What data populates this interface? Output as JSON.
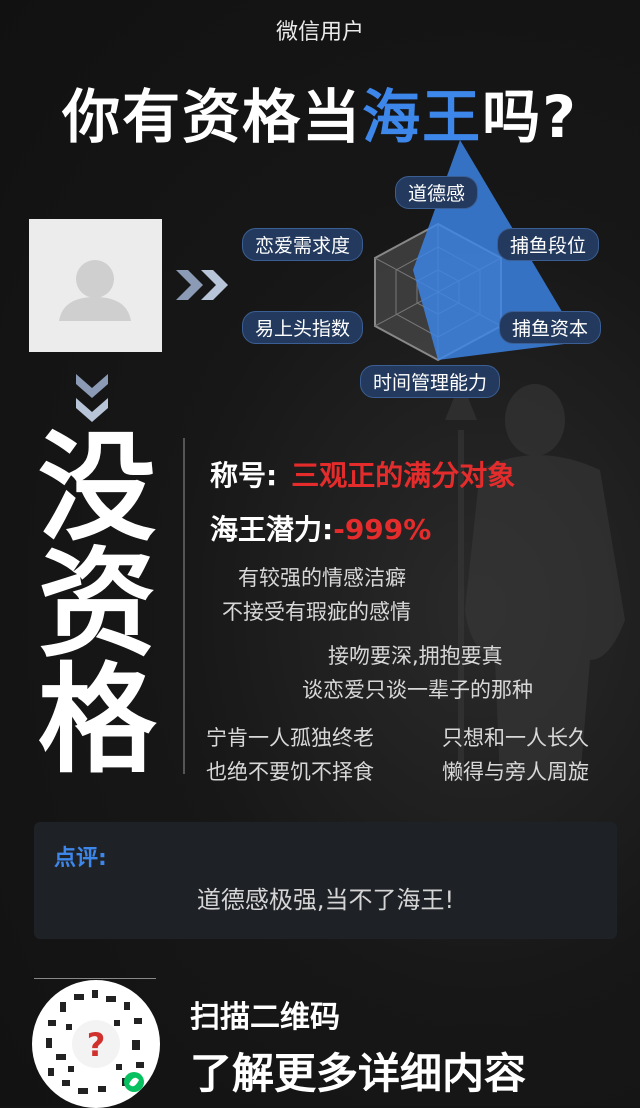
{
  "header": {
    "user": "微信用户",
    "title_pre": "你有资格当",
    "title_highlight": "海王",
    "title_post": "吗?"
  },
  "radar": {
    "labels": [
      "道德感",
      "捕鱼段位",
      "捕鱼资本",
      "时间管理能力",
      "易上头指数",
      "恋爱需求度"
    ],
    "accent": "#3d86ea"
  },
  "result": {
    "verdict": [
      "没",
      "资",
      "格"
    ],
    "title_label": "称号:",
    "title_value": "三观正的满分对象",
    "potential_label": "海王潜力:",
    "potential_value": "-999%"
  },
  "traits": [
    "有较强的情感洁癖",
    "不接受有瑕疵的感情",
    "接吻要深,拥抱要真",
    "谈恋爱只谈一辈子的那种",
    "宁肯一人孤独终老",
    "只想和一人长久",
    "也绝不要饥不择食",
    "懒得与旁人周旋"
  ],
  "review": {
    "title": "点评:",
    "content": "道德感极强,当不了海王!"
  },
  "footer": {
    "scan": "扫描二维码",
    "more": "了解更多详细内容"
  },
  "icons": [
    "avatar-placeholder-icon",
    "chevron-right-icon",
    "chevron-down-icon",
    "qr-code-icon",
    "mini-program-icon"
  ]
}
